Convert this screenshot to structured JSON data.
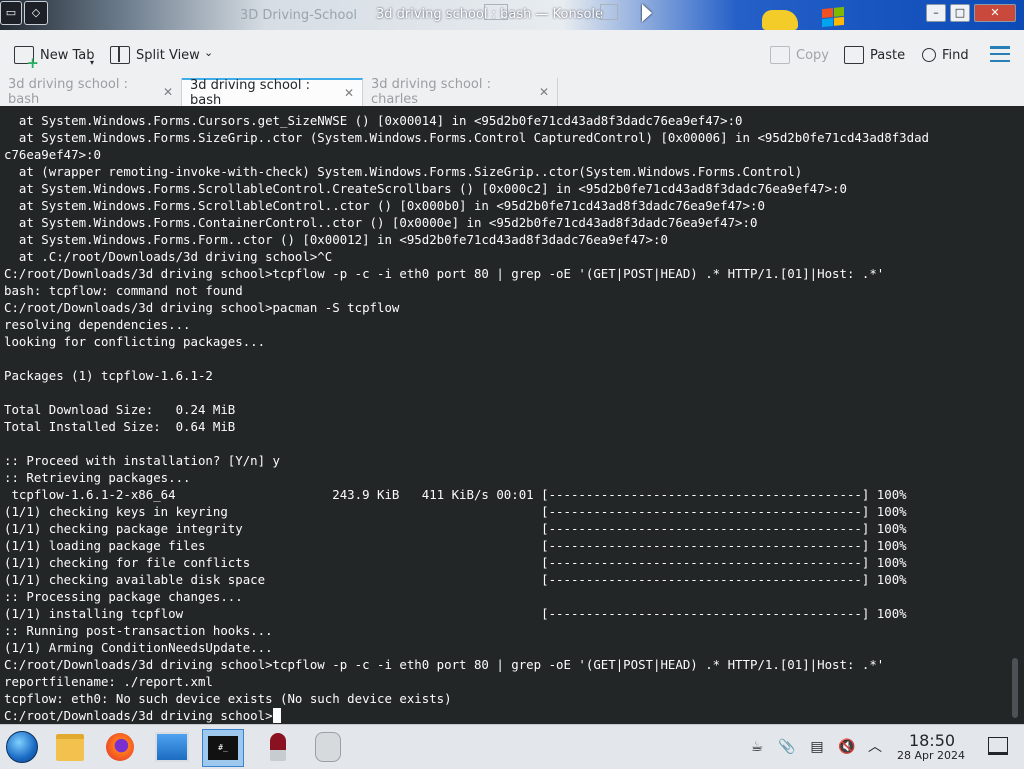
{
  "window": {
    "left_icon": "▭",
    "menu_icon": "◇",
    "ghost_title": "3D Driving-School",
    "title": "3d driving school : bash — Konsole"
  },
  "toolbar": {
    "new_tab": "New Tab",
    "split_view": "Split View",
    "copy": "Copy",
    "paste": "Paste",
    "find": "Find"
  },
  "tabs": [
    {
      "label": "3d driving school : bash",
      "active": false
    },
    {
      "label": "3d driving school : bash",
      "active": true
    },
    {
      "label": "3d driving school : charles",
      "active": false
    }
  ],
  "terminal": {
    "lines": [
      "  at System.Windows.Forms.Cursors.get_SizeNWSE () [0x00014] in <95d2b0fe71cd43ad8f3dadc76ea9ef47>:0",
      "  at System.Windows.Forms.SizeGrip..ctor (System.Windows.Forms.Control CapturedControl) [0x00006] in <95d2b0fe71cd43ad8f3dad",
      "c76ea9ef47>:0",
      "  at (wrapper remoting-invoke-with-check) System.Windows.Forms.SizeGrip..ctor(System.Windows.Forms.Control)",
      "  at System.Windows.Forms.ScrollableControl.CreateScrollbars () [0x000c2] in <95d2b0fe71cd43ad8f3dadc76ea9ef47>:0",
      "  at System.Windows.Forms.ScrollableControl..ctor () [0x000b0] in <95d2b0fe71cd43ad8f3dadc76ea9ef47>:0",
      "  at System.Windows.Forms.ContainerControl..ctor () [0x0000e] in <95d2b0fe71cd43ad8f3dadc76ea9ef47>:0",
      "  at System.Windows.Forms.Form..ctor () [0x00012] in <95d2b0fe71cd43ad8f3dadc76ea9ef47>:0",
      "  at .C:/root/Downloads/3d driving school>^C",
      "C:/root/Downloads/3d driving school>tcpflow -p -c -i eth0 port 80 | grep -oE '(GET|POST|HEAD) .* HTTP/1.[01]|Host: .*'",
      "bash: tcpflow: command not found",
      "C:/root/Downloads/3d driving school>pacman -S tcpflow",
      "resolving dependencies...",
      "looking for conflicting packages...",
      "",
      "Packages (1) tcpflow-1.6.1-2",
      "",
      "Total Download Size:   0.24 MiB",
      "Total Installed Size:  0.64 MiB",
      "",
      ":: Proceed with installation? [Y/n] y",
      ":: Retrieving packages...",
      " tcpflow-1.6.1-2-x86_64                     243.9 KiB   411 KiB/s 00:01 [------------------------------------------] 100%",
      "(1/1) checking keys in keyring                                          [------------------------------------------] 100%",
      "(1/1) checking package integrity                                        [------------------------------------------] 100%",
      "(1/1) loading package files                                             [------------------------------------------] 100%",
      "(1/1) checking for file conflicts                                       [------------------------------------------] 100%",
      "(1/1) checking available disk space                                     [------------------------------------------] 100%",
      ":: Processing package changes...",
      "(1/1) installing tcpflow                                                [------------------------------------------] 100%",
      ":: Running post-transaction hooks...",
      "(1/1) Arming ConditionNeedsUpdate...",
      "C:/root/Downloads/3d driving school>tcpflow -p -c -i eth0 port 80 | grep -oE '(GET|POST|HEAD) .* HTTP/1.[01]|Host: .*'",
      "reportfilename: ./report.xml",
      "tcpflow: eth0: No such device exists (No such device exists)"
    ],
    "prompt": "C:/root/Downloads/3d driving school>"
  },
  "taskbar": {
    "terminal_icon_text": "#_",
    "clock_time": "18:50",
    "clock_date": "28 Apr 2024"
  },
  "colors": {
    "terminal_bg": "#232627",
    "terminal_fg": "#fcfcfc",
    "accent": "#3daee9",
    "hamburger": "#2980b9"
  }
}
